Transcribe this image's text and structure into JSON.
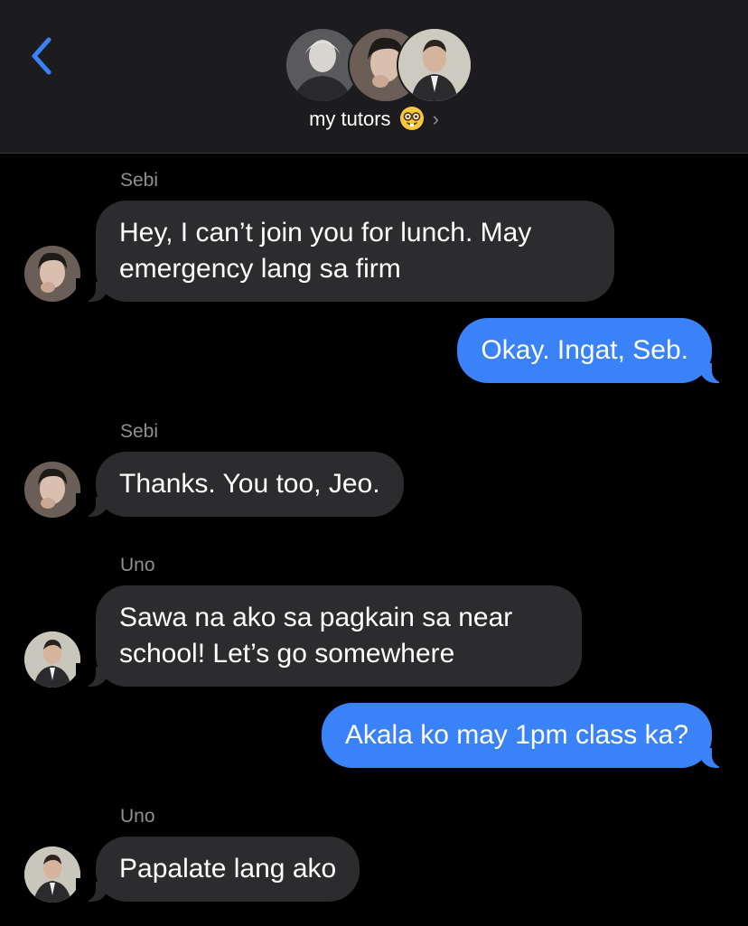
{
  "header": {
    "back_icon": "chevron-left-icon",
    "accent_color": "#3a82f7",
    "group_name": "my tutors",
    "group_emoji": "nerd-face-emoji",
    "disclosure_icon": "chevron-right-icon"
  },
  "messages": [
    {
      "sender": "Sebi",
      "text": "Hey, I can’t join you for lunch. May emergency lang sa firm",
      "direction": "incoming"
    },
    {
      "text": "Okay. Ingat, Seb.",
      "direction": "outgoing"
    },
    {
      "sender": "Sebi",
      "text": "Thanks. You too, Jeo.",
      "direction": "incoming"
    },
    {
      "sender": "Uno",
      "text": "Sawa na ako sa pagkain sa near school! Let’s go somewhere",
      "direction": "incoming"
    },
    {
      "text": "Akala ko may 1pm class ka?",
      "direction": "outgoing"
    },
    {
      "sender": "Uno",
      "text": "Papalate lang ako",
      "direction": "incoming"
    }
  ],
  "colors": {
    "incoming_bubble": "#2c2c2e",
    "outgoing_bubble": "#3a82f7",
    "header_bg": "#1c1c1e"
  }
}
